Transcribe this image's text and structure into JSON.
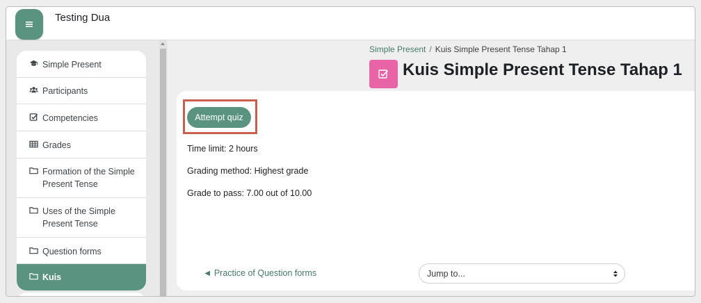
{
  "header": {
    "site_title": "Testing Dua",
    "menu_icon": "hamburger-icon"
  },
  "sidebar": {
    "items": [
      {
        "label": "Simple Present",
        "icon": "graduation-cap-icon"
      },
      {
        "label": "Participants",
        "icon": "users-icon"
      },
      {
        "label": "Competencies",
        "icon": "checkbox-icon"
      },
      {
        "label": "Grades",
        "icon": "table-icon"
      },
      {
        "label": "Formation of the Simple Present Tense",
        "icon": "folder-icon"
      },
      {
        "label": "Uses of the Simple Present Tense",
        "icon": "folder-icon"
      },
      {
        "label": "Question forms",
        "icon": "folder-icon"
      },
      {
        "label": "Kuis",
        "icon": "folder-icon",
        "active": true
      }
    ]
  },
  "breadcrumb": {
    "items": [
      "Simple Present",
      "Kuis Simple Present Tense Tahap 1"
    ],
    "separator": "/"
  },
  "page": {
    "title": "Kuis Simple Present Tense Tahap 1",
    "icon": "quiz-checkbox-icon",
    "icon_color": "#e764a6"
  },
  "quiz": {
    "attempt_button": "Attempt quiz",
    "time_limit": "Time limit: 2 hours",
    "grading_method": "Grading method: Highest grade",
    "grade_to_pass": "Grade to pass: 7.00 out of 10.00"
  },
  "navigation": {
    "prev_link": "◄ Practice of Question forms",
    "jump_placeholder": "Jump to..."
  },
  "colors": {
    "accent": "#5a9481",
    "highlight_border": "#c9604e",
    "link": "#467a69"
  }
}
